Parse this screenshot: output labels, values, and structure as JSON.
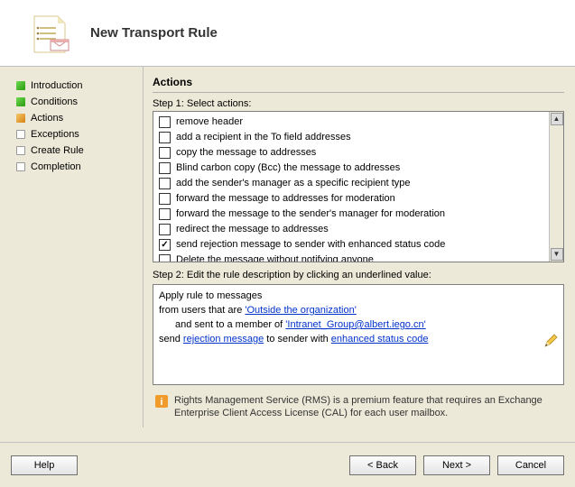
{
  "header": {
    "title": "New Transport Rule"
  },
  "nav": {
    "items": [
      {
        "label": "Introduction",
        "state": "done"
      },
      {
        "label": "Conditions",
        "state": "done"
      },
      {
        "label": "Actions",
        "state": "current"
      },
      {
        "label": "Exceptions",
        "state": "todo"
      },
      {
        "label": "Create Rule",
        "state": "todo"
      },
      {
        "label": "Completion",
        "state": "todo"
      }
    ]
  },
  "main": {
    "section_title": "Actions",
    "step1_label": "Step 1: Select actions:",
    "actions": [
      {
        "label": "remove header",
        "checked": false
      },
      {
        "label": "add a recipient in the To field addresses",
        "checked": false
      },
      {
        "label": "copy the message to addresses",
        "checked": false
      },
      {
        "label": "Blind carbon copy (Bcc) the message to addresses",
        "checked": false
      },
      {
        "label": "add the sender's manager as a specific recipient type",
        "checked": false
      },
      {
        "label": "forward the message to addresses for moderation",
        "checked": false
      },
      {
        "label": "forward the message to the sender's manager for moderation",
        "checked": false
      },
      {
        "label": "redirect the message to addresses",
        "checked": false
      },
      {
        "label": "send rejection message to sender with enhanced status code",
        "checked": true
      },
      {
        "label": "Delete the message without notifying anyone",
        "checked": false
      }
    ],
    "step2_label": "Step 2: Edit the rule description by clicking an underlined value:",
    "desc": {
      "line1": "Apply rule to messages",
      "line2_pre": "from users that are ",
      "line2_link": "'Outside the organization'",
      "line3_pre": "and sent to a member of ",
      "line3_link": "'Intranet_Group@albert.iego.cn'",
      "line4_pre": "send ",
      "line4_link1": "rejection message",
      "line4_mid": " to sender with ",
      "line4_link2": "enhanced status code"
    },
    "info": "Rights Management Service (RMS) is a premium feature that requires an Exchange Enterprise Client Access License (CAL) for each user mailbox."
  },
  "footer": {
    "help": "Help",
    "back": "< Back",
    "next": "Next >",
    "cancel": "Cancel"
  }
}
